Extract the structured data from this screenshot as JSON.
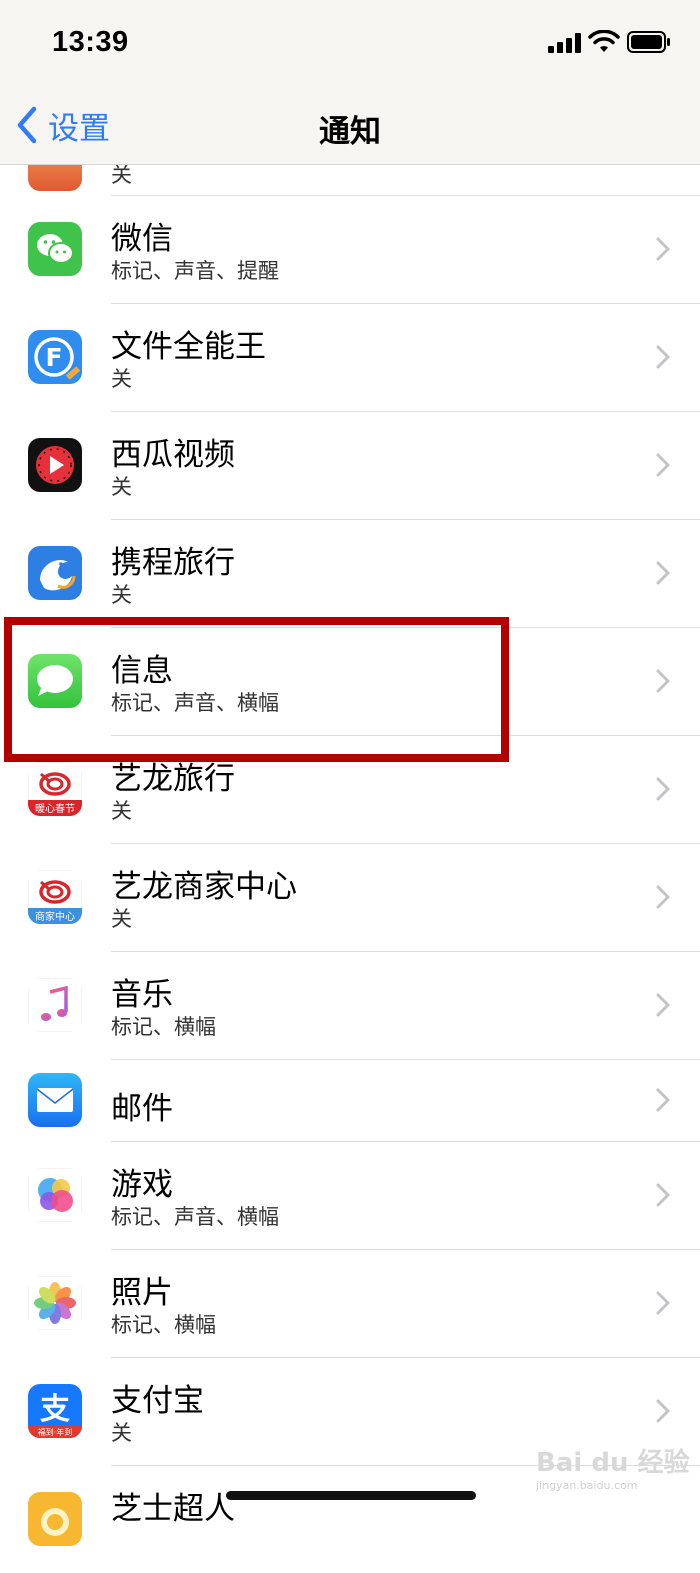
{
  "status": {
    "time": "13:39"
  },
  "nav": {
    "back_label": "设置",
    "title": "通知"
  },
  "partial_row": {
    "subtitle": "关"
  },
  "rows": [
    {
      "title": "微信",
      "subtitle": "标记、声音、提醒",
      "icon": "wechat-icon"
    },
    {
      "title": "文件全能王",
      "subtitle": "关",
      "icon": "file-master-icon"
    },
    {
      "title": "西瓜视频",
      "subtitle": "关",
      "icon": "xigua-video-icon"
    },
    {
      "title": "携程旅行",
      "subtitle": "关",
      "icon": "ctrip-icon"
    },
    {
      "title": "信息",
      "subtitle": "标记、声音、横幅",
      "icon": "messages-icon"
    },
    {
      "title": "艺龙旅行",
      "subtitle": "关",
      "icon": "elong-icon"
    },
    {
      "title": "艺龙商家中心",
      "subtitle": "关",
      "icon": "elong-merchant-icon"
    },
    {
      "title": "音乐",
      "subtitle": "标记、横幅",
      "icon": "music-icon"
    },
    {
      "title": "邮件",
      "subtitle": "",
      "icon": "mail-icon"
    },
    {
      "title": "游戏",
      "subtitle": "标记、声音、横幅",
      "icon": "game-center-icon"
    },
    {
      "title": "照片",
      "subtitle": "标记、横幅",
      "icon": "photos-icon"
    },
    {
      "title": "支付宝",
      "subtitle": "关",
      "icon": "alipay-icon"
    },
    {
      "title": "芝士超人",
      "subtitle": "",
      "icon": "cheese-superman-icon"
    }
  ],
  "icon_text": {
    "file_master": "F",
    "elong_badge": "暖心春节",
    "elong_merchant_badge": "商家中心",
    "alipay_glyph": "支",
    "alipay_badge": "福到·年到"
  },
  "watermark": {
    "brand": "Bai du 经验",
    "url": "jingyan.baidu.com"
  },
  "colors": {
    "accent": "#2f7cf6",
    "highlight": "#b50000"
  }
}
